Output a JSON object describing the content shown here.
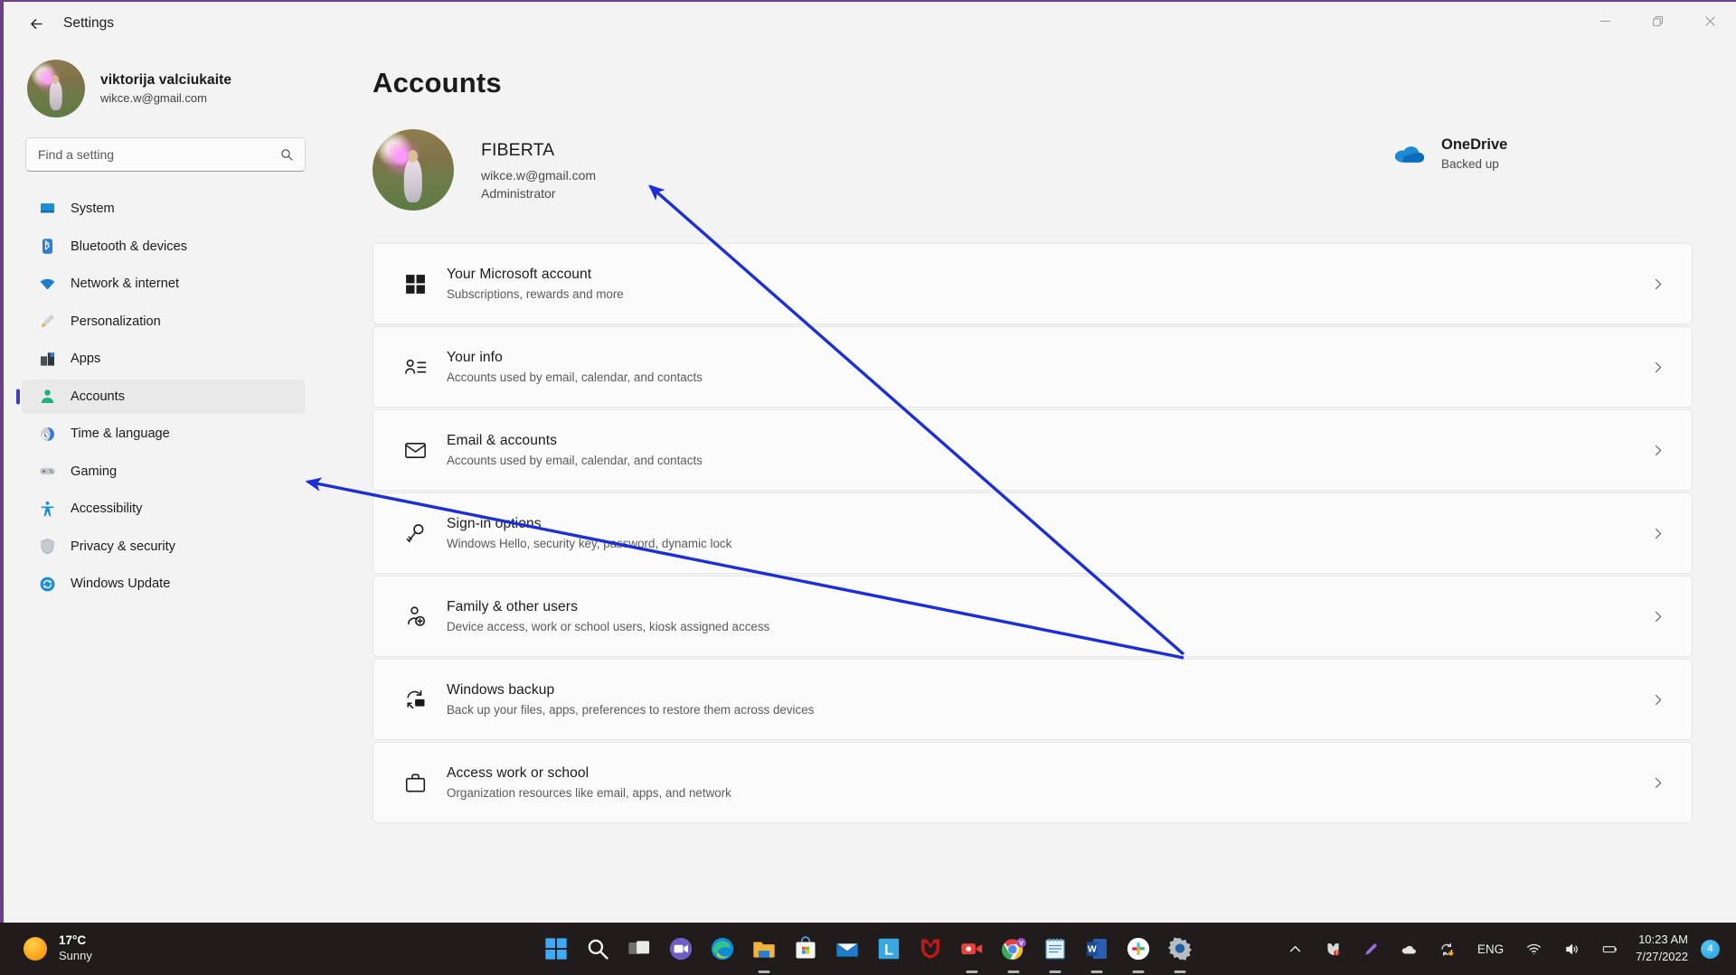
{
  "window": {
    "title": "Settings",
    "back_label": "Back",
    "controls": {
      "minimize": "Minimize",
      "restore": "Restore",
      "close": "Close"
    }
  },
  "sidebar": {
    "profile": {
      "name": "viktorija valciukaite",
      "email": "wikce.w@gmail.com"
    },
    "search": {
      "placeholder": "Find a setting",
      "value": ""
    },
    "items": [
      {
        "label": "System",
        "icon": "monitor-icon",
        "selected": false
      },
      {
        "label": "Bluetooth & devices",
        "icon": "bluetooth-icon",
        "selected": false
      },
      {
        "label": "Network & internet",
        "icon": "wifi-icon",
        "selected": false
      },
      {
        "label": "Personalization",
        "icon": "brush-icon",
        "selected": false
      },
      {
        "label": "Apps",
        "icon": "apps-icon",
        "selected": false
      },
      {
        "label": "Accounts",
        "icon": "person-icon",
        "selected": true
      },
      {
        "label": "Time & language",
        "icon": "clock-globe-icon",
        "selected": false
      },
      {
        "label": "Gaming",
        "icon": "gamepad-icon",
        "selected": false
      },
      {
        "label": "Accessibility",
        "icon": "accessibility-icon",
        "selected": false
      },
      {
        "label": "Privacy & security",
        "icon": "shield-icon",
        "selected": false
      },
      {
        "label": "Windows Update",
        "icon": "update-icon",
        "selected": false
      }
    ]
  },
  "main": {
    "page_title": "Accounts",
    "account": {
      "name": "FIBERTA",
      "email": "wikce.w@gmail.com",
      "role": "Administrator"
    },
    "onedrive": {
      "title": "OneDrive",
      "status": "Backed up",
      "icon": "cloud-icon"
    },
    "cards": [
      {
        "title": "Your Microsoft account",
        "sub": "Subscriptions, rewards and more",
        "icon": "windows-logo-icon"
      },
      {
        "title": "Your info",
        "sub": "Accounts used by email, calendar, and contacts",
        "icon": "person-info-icon"
      },
      {
        "title": "Email & accounts",
        "sub": "Accounts used by email, calendar, and contacts",
        "icon": "mail-icon"
      },
      {
        "title": "Sign-in options",
        "sub": "Windows Hello, security key, password, dynamic lock",
        "icon": "key-icon"
      },
      {
        "title": "Family & other users",
        "sub": "Device access, work or school users, kiosk assigned access",
        "icon": "person-add-icon"
      },
      {
        "title": "Windows backup",
        "sub": "Back up your files, apps, preferences to restore them across devices",
        "icon": "backup-icon"
      },
      {
        "title": "Access work or school",
        "sub": "Organization resources like email, apps, and network",
        "icon": "briefcase-icon"
      }
    ]
  },
  "annotations": {
    "color": "#1c2fd6"
  },
  "taskbar": {
    "weather": {
      "temperature": "17°C",
      "condition": "Sunny",
      "icon": "sun-icon"
    },
    "apps": [
      {
        "name": "start-button",
        "icon": "windows-start-icon",
        "active": false
      },
      {
        "name": "search-button",
        "icon": "search-icon",
        "active": false
      },
      {
        "name": "task-view-button",
        "icon": "task-view-icon",
        "active": false
      },
      {
        "name": "teams-button",
        "icon": "teams-icon",
        "active": false
      },
      {
        "name": "edge-button",
        "icon": "edge-icon",
        "active": false
      },
      {
        "name": "file-explorer-button",
        "icon": "folder-icon",
        "active": true
      },
      {
        "name": "store-button",
        "icon": "store-icon",
        "active": false
      },
      {
        "name": "mail-button",
        "icon": "mail-app-icon",
        "active": false
      },
      {
        "name": "lightshot-button",
        "icon": "letter-l-icon",
        "active": false
      },
      {
        "name": "mcafee-button",
        "icon": "mcafee-shield-icon",
        "active": false
      },
      {
        "name": "screen-recorder-button",
        "icon": "camcorder-icon",
        "active": true
      },
      {
        "name": "chrome-button",
        "icon": "chrome-icon",
        "active": true
      },
      {
        "name": "notepad-button",
        "icon": "notepad-icon",
        "active": true
      },
      {
        "name": "word-button",
        "icon": "word-icon",
        "active": true
      },
      {
        "name": "slack-button",
        "icon": "slack-icon",
        "active": true
      },
      {
        "name": "settings-button",
        "icon": "gear-icon",
        "active": true
      }
    ],
    "tray": {
      "overflow_icon": "chevron-up-icon",
      "icons": [
        "mcafee-tray-icon",
        "pen-tray-icon",
        "onedrive-tray-icon",
        "sync-tray-icon"
      ],
      "language": "ENG",
      "network_icon": "wifi-icon",
      "volume_icon": "speaker-icon",
      "battery_icon": "battery-icon",
      "time": "10:23 AM",
      "date": "7/27/2022",
      "notification_badge": "4"
    }
  }
}
